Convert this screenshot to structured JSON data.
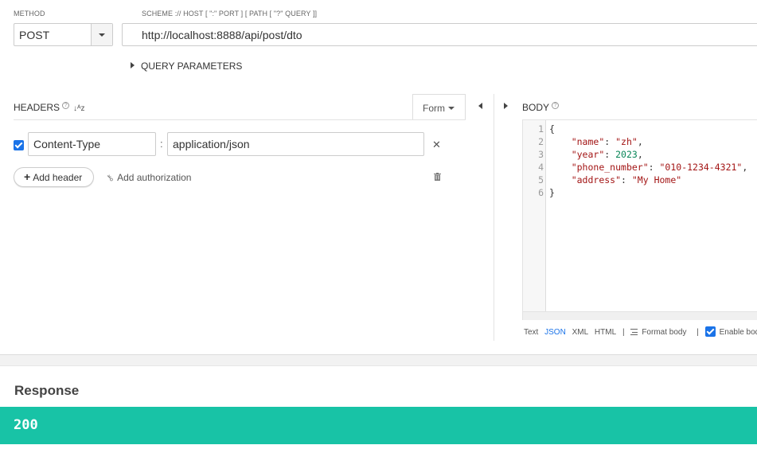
{
  "request": {
    "method_label": "METHOD",
    "method_value": "POST",
    "url_label": "SCHEME :// HOST [ \":\" PORT ] [ PATH [ \"?\" QUERY ]]",
    "url_value": "http://localhost:8888/api/post/dto",
    "query_params_label": "QUERY PARAMETERS"
  },
  "headers": {
    "title": "HEADERS",
    "form_label": "Form",
    "items": [
      {
        "checked": true,
        "name": "Content-Type",
        "value": "application/json"
      }
    ],
    "add_header_label": "Add header",
    "add_authorization_label": "Add authorization"
  },
  "body": {
    "title": "BODY",
    "line_numbers": [
      "1",
      "2",
      "3",
      "4",
      "5",
      "6"
    ],
    "code": {
      "open": "{",
      "close": "}",
      "fields": [
        {
          "key": "\"name\"",
          "value": "\"zh\"",
          "type": "string",
          "trail": ","
        },
        {
          "key": "\"year\"",
          "value": "2023",
          "type": "number",
          "trail": ","
        },
        {
          "key": "\"phone_number\"",
          "value": "\"010-1234-4321\"",
          "type": "string",
          "trail": ","
        },
        {
          "key": "\"address\"",
          "value": "\"My Home\"",
          "type": "string",
          "trail": ""
        }
      ]
    },
    "toolbar": {
      "text": "Text",
      "json": "JSON",
      "xml": "XML",
      "html": "HTML",
      "sep": "|",
      "format_body": "Format body",
      "enable_body": "Enable body"
    }
  },
  "response": {
    "title": "Response",
    "status_code": "200",
    "status_color": "#18c3a6"
  },
  "colors": {
    "accent": "#1a73e8",
    "json_key": "#a31515",
    "json_number": "#098658"
  },
  "icons": [
    "help-icon",
    "sort-az-icon",
    "chevron-down-icon",
    "collapse-left-icon",
    "expand-right-icon",
    "close-icon",
    "plus-icon",
    "key-icon",
    "trash-icon",
    "format-icon",
    "checkbox-icon"
  ]
}
